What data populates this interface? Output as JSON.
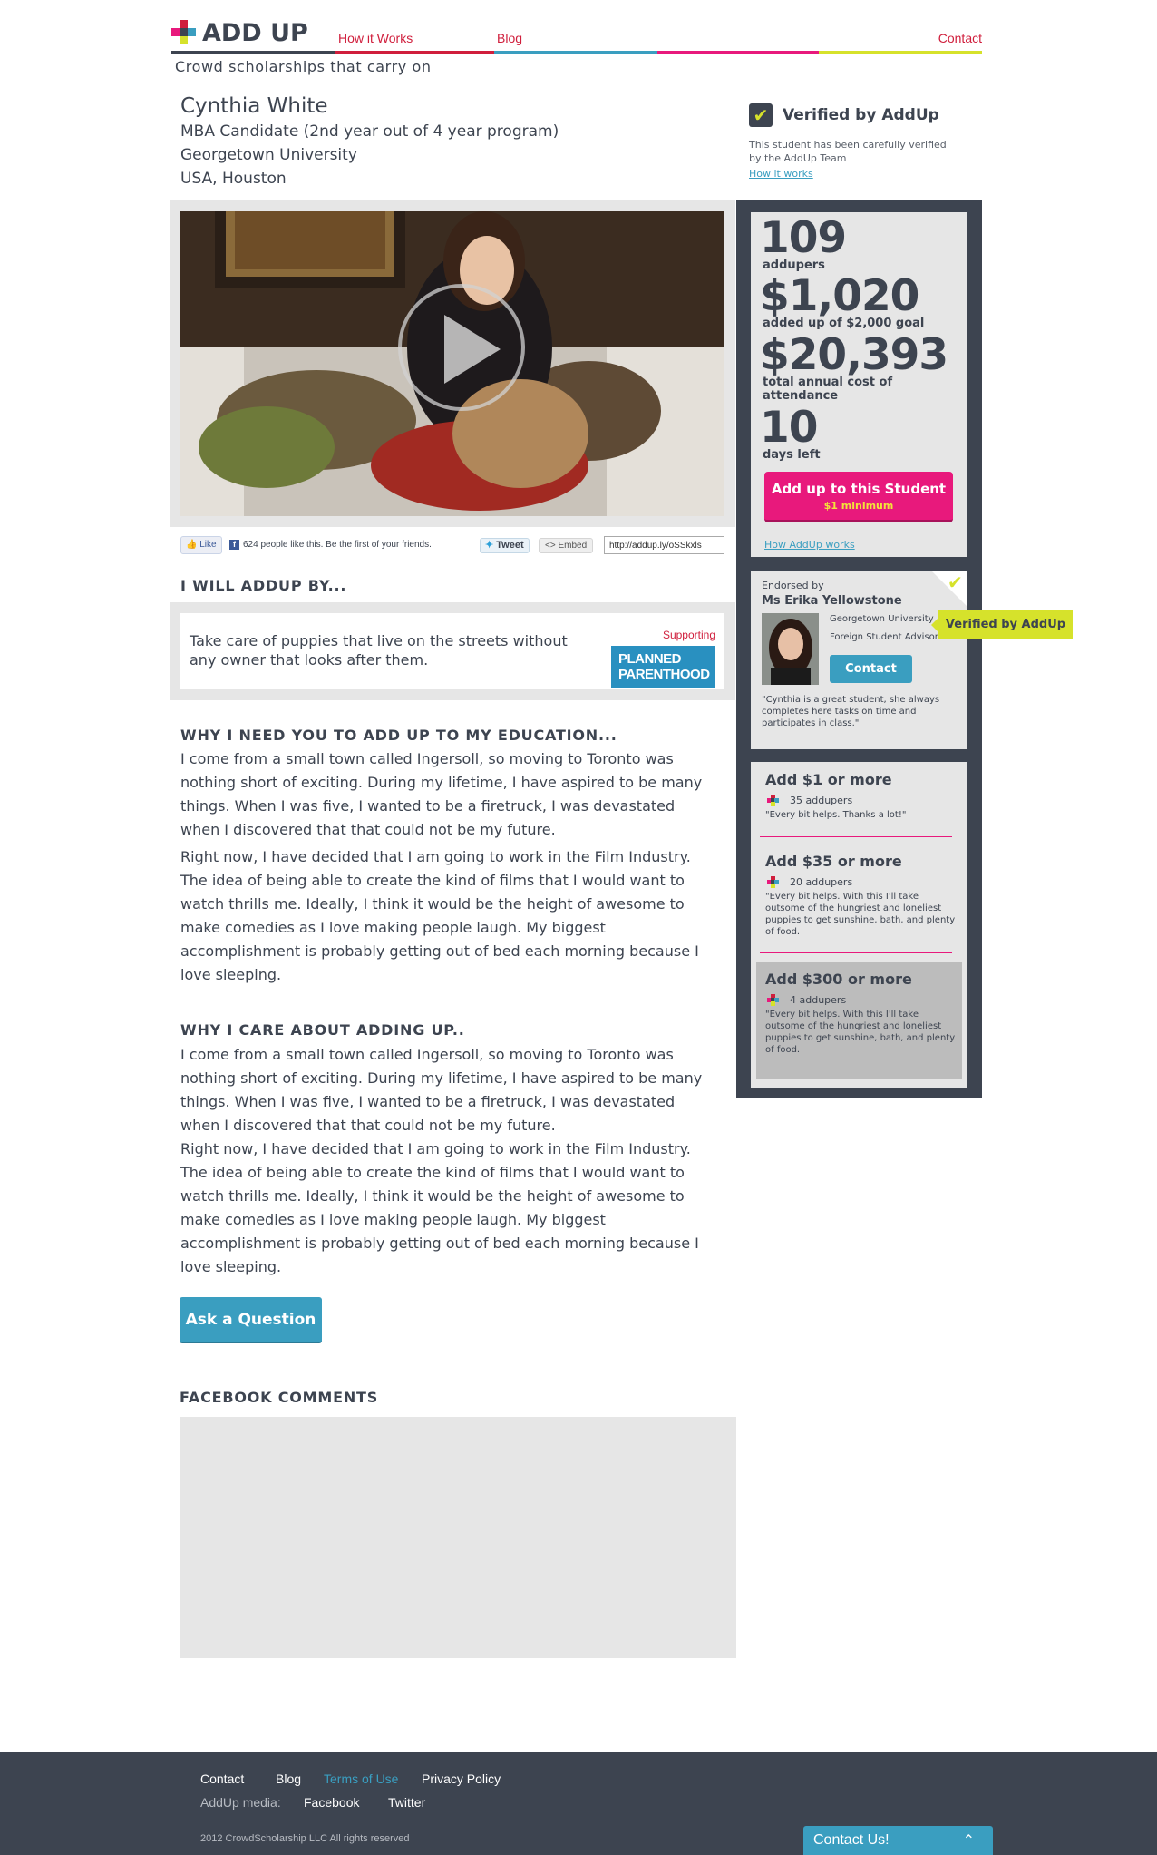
{
  "brand": {
    "name": "ADD UP",
    "tagline": "Crowd scholarships that carry on",
    "colors": {
      "dark": "#3d4450",
      "red": "#d01e3c",
      "teal": "#3a9ec0",
      "pink": "#e8197c",
      "yellow": "#d6e22b"
    }
  },
  "nav": {
    "how_it_works": "How it Works",
    "blog": "Blog",
    "contact": "Contact"
  },
  "student": {
    "name": "Cynthia White",
    "program": "MBA Candidate (2nd year out of 4 year program)",
    "university": "Georgetown University",
    "location": "USA, Houston"
  },
  "verified": {
    "title": "Verified by AddUp",
    "description": "This student has been carefully verified by the AddUp Team",
    "link": "How it works"
  },
  "video": {
    "play_icon": "play-icon"
  },
  "share": {
    "like": "Like",
    "like_text": "624 people like this. Be the first of your friends.",
    "tweet": "Tweet",
    "embed": "Embed",
    "url": "http://addup.ly/oSSkxls"
  },
  "will_addup": {
    "heading": "I WILL ADDUP BY...",
    "text": "Take care of puppies that live on the streets without any owner that looks after them.",
    "supporting_label": "Supporting",
    "org_line1": "PLANNED",
    "org_line2": "PARENTHOOD"
  },
  "why_need": {
    "heading": "WHY I NEED YOU TO ADD UP TO MY EDUCATION...",
    "p1": "I come from a small town called Ingersoll, so moving to Toronto was nothing short of exciting. During my lifetime, I have aspired to be many things. When I was five, I wanted to be a firetruck, I was devastated when I discovered that that could not be my future.",
    "p2": "Right now, I have decided that I am going to work in the Film Industry. The idea of being able to create the kind of films that I would want to watch thrills me. Ideally, I think it would be the height of awesome to make comedies as I love making people laugh. My biggest accomplishment is probably getting out of bed each morning because I love sleeping."
  },
  "why_care": {
    "heading": "WHY I CARE ABOUT ADDING UP..",
    "p1": "I come from a small town called Ingersoll, so moving to Toronto was nothing short of exciting. During my lifetime, I have aspired to be many things. When I was five, I wanted to be a firetruck, I was devastated when I discovered that that could not be my future.",
    "p2": "Right now, I have decided that I am going to work in the Film Industry. The idea of being able to create the kind of films that I would want to watch thrills me. Ideally, I think it would be the height of awesome to make comedies as I love making people laugh. My biggest accomplishment is probably getting out of bed each morning because I love sleeping."
  },
  "ask_button": "Ask a Question",
  "fb_comments_heading": "FACEBOOK COMMENTS",
  "stats": {
    "addupers_value": "109",
    "addupers_label": "addupers",
    "raised_value": "$1,020",
    "raised_label": "added up of $2,000 goal",
    "cost_value": "$20,393",
    "cost_label": "total annual cost of attendance",
    "days_value": "10",
    "days_label": "days left",
    "cta": "Add up to this Student",
    "cta_min": "$1 minimum",
    "how_link": "How AddUp works"
  },
  "endorsement": {
    "label": "Endorsed by",
    "name": "Ms Erika Yellowstone",
    "university": "Georgetown University",
    "role": "Foreign Student Advisor",
    "contact": "Contact",
    "quote": "\"Cynthia is a great student, she always completes here tasks on time and participates in class.\"",
    "verified_tag": "Verified by AddUp"
  },
  "rewards": [
    {
      "title": "Add $1 or more",
      "count": "35 addupers",
      "desc": "\"Every bit helps. Thanks a lot!\""
    },
    {
      "title": "Add $35 or more",
      "count": "20 addupers",
      "desc": "\"Every bit helps. With this I'll take outsome of the hungriest and loneliest puppies to get sunshine, bath, and plenty of food."
    },
    {
      "title": "Add $300 or more",
      "count": "4 addupers",
      "desc": "\"Every bit helps. With this I'll take outsome of the hungriest and loneliest puppies to get sunshine, bath, and plenty of food."
    }
  ],
  "footer": {
    "contact": "Contact",
    "blog": "Blog",
    "terms": "Terms of Use",
    "privacy": "Privacy Policy",
    "media_label": "AddUp media:",
    "facebook": "Facebook",
    "twitter": "Twitter",
    "copyright": "2012 CrowdScholarship LLC All rights reserved",
    "contact_us": "Contact Us!"
  }
}
